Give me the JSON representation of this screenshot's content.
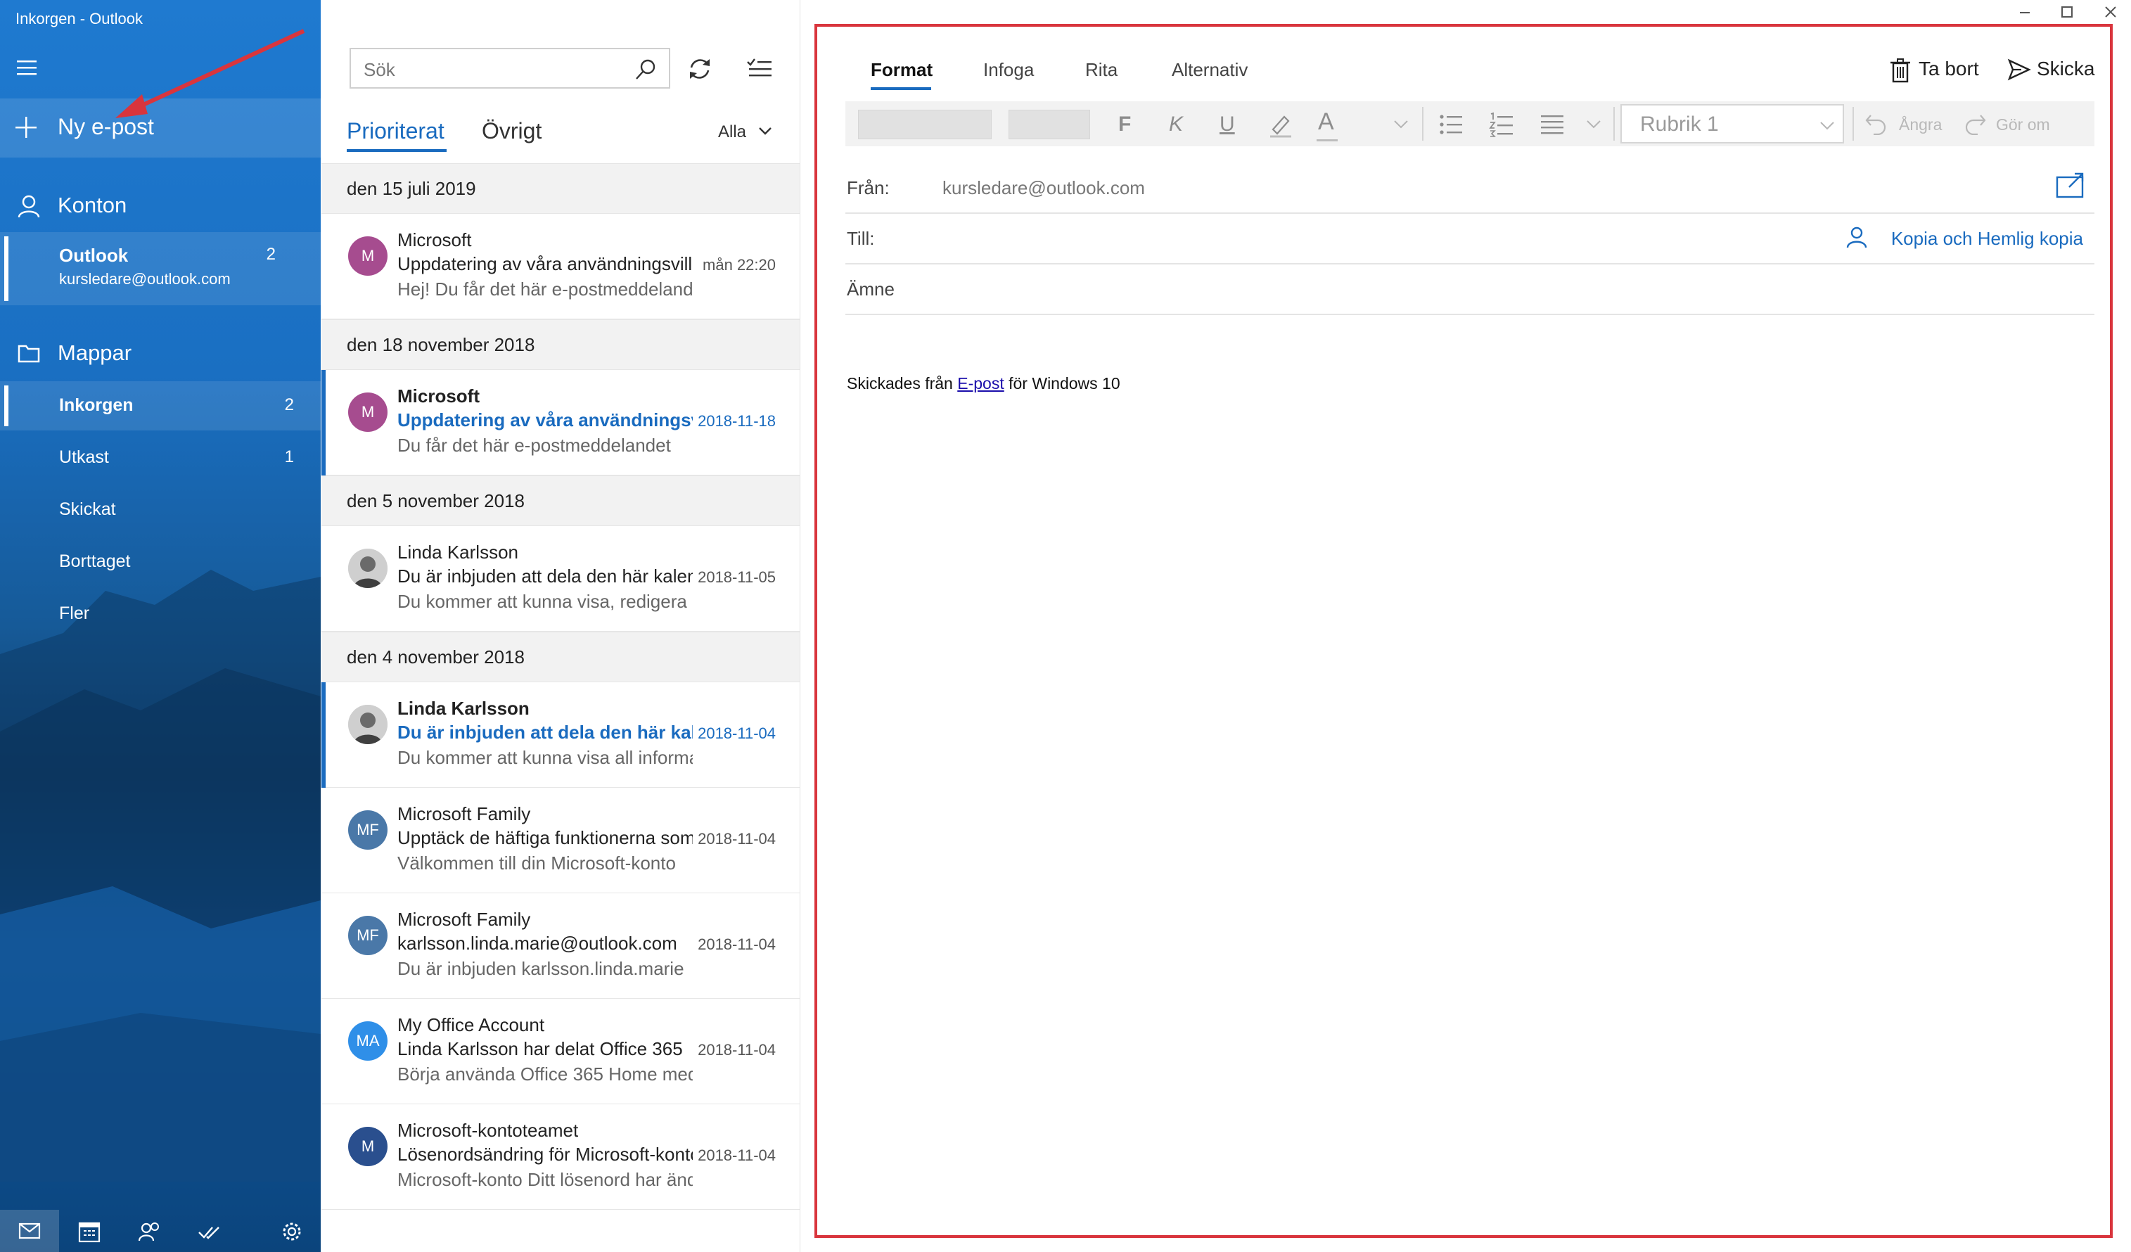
{
  "window": {
    "title": "Inkorgen - Outlook"
  },
  "sidebar": {
    "new_mail_label": "Ny e-post",
    "accounts_heading": "Konton",
    "account": {
      "name": "Outlook",
      "email": "kursledare@outlook.com",
      "count": "2"
    },
    "folders_heading": "Mappar",
    "folders": [
      {
        "label": "Inkorgen",
        "count": "2"
      },
      {
        "label": "Utkast",
        "count": "1"
      },
      {
        "label": "Skickat",
        "count": ""
      },
      {
        "label": "Borttaget",
        "count": ""
      },
      {
        "label": "Fler",
        "count": ""
      }
    ],
    "bottom_icons": [
      "mail-icon",
      "calendar-icon",
      "people-icon",
      "todo-icon",
      "settings-icon"
    ]
  },
  "message_list": {
    "search_placeholder": "Sök",
    "tabs": [
      "Prioriterat",
      "Övrigt"
    ],
    "filter_label": "Alla",
    "groups": [
      {
        "date_header": "den 15 juli 2019"
      },
      {
        "date_header": "den 18 november 2018"
      },
      {
        "date_header": "den 5 november 2018"
      },
      {
        "date_header": "den 4 november 2018"
      }
    ],
    "messages": [
      {
        "initials": "M",
        "avatar_color": "#a64c8f",
        "from": "Microsoft",
        "subject": "Uppdatering av våra användningsvillkor",
        "preview": "Hej! Du får det här e-postmeddelandet",
        "date": "mån 22:20",
        "unread": false
      },
      {
        "initials": "M",
        "avatar_color": "#a64c8f",
        "from": "Microsoft",
        "subject": "Uppdatering av våra användningsvillkor",
        "preview": "Du får det här e-postmeddelandet",
        "date": "2018-11-18",
        "unread": true
      },
      {
        "initials": "",
        "avatar_color": "#8a8a8a",
        "from": "Linda Karlsson",
        "subject": "Du är inbjuden att dela den här kalendern",
        "preview": "Du kommer att kunna visa, redigera",
        "date": "2018-11-05",
        "unread": false
      },
      {
        "initials": "",
        "avatar_color": "#8a8a8a",
        "from": "Linda Karlsson",
        "subject": "Du är inbjuden att dela den här kalendern",
        "preview": "Du kommer att kunna visa all information",
        "date": "2018-11-04",
        "unread": true
      },
      {
        "initials": "MF",
        "avatar_color": "#4a78a8",
        "from": "Microsoft Family",
        "subject": "Upptäck de häftiga funktionerna som",
        "preview": "Välkommen till din Microsoft-konto",
        "date": "2018-11-04",
        "unread": false
      },
      {
        "initials": "MF",
        "avatar_color": "#4a78a8",
        "from": "Microsoft Family",
        "subject": "karlsson.linda.marie@outlook.com",
        "preview": "Du är inbjuden karlsson.linda.marie",
        "date": "2018-11-04",
        "unread": false
      },
      {
        "initials": "MA",
        "avatar_color": "#2f8fe8",
        "from": "My Office Account",
        "subject": "Linda Karlsson har delat Office 365",
        "preview": "Börja använda Office 365 Home med",
        "date": "2018-11-04",
        "unread": false
      },
      {
        "initials": "M",
        "avatar_color": "#2a4f8e",
        "from": "Microsoft-kontoteamet",
        "subject": "Lösenordsändring för Microsoft-konto",
        "preview": "Microsoft-konto Ditt lösenord har ändrats",
        "date": "2018-11-04",
        "unread": false
      }
    ]
  },
  "compose": {
    "tabs": [
      "Format",
      "Infoga",
      "Rita",
      "Alternativ"
    ],
    "delete_label": "Ta bort",
    "send_label": "Skicka",
    "toolbar": {
      "bold": "F",
      "italic": "K",
      "underline": "U",
      "font_color": "A",
      "style": "Rubrik 1",
      "undo": "Ångra",
      "redo": "Gör om"
    },
    "from_label": "Från:",
    "from_value": "kursledare@outlook.com",
    "to_label": "Till:",
    "cc_label": "Kopia och Hemlig kopia",
    "subject_label": "Ämne",
    "signature_prefix": "Skickades från ",
    "signature_link": "E-post",
    "signature_suffix": " för Windows 10"
  },
  "colors": {
    "accent": "#1a6bbf",
    "highlight_frame": "#d9353d",
    "arrow": "#d9353d"
  }
}
